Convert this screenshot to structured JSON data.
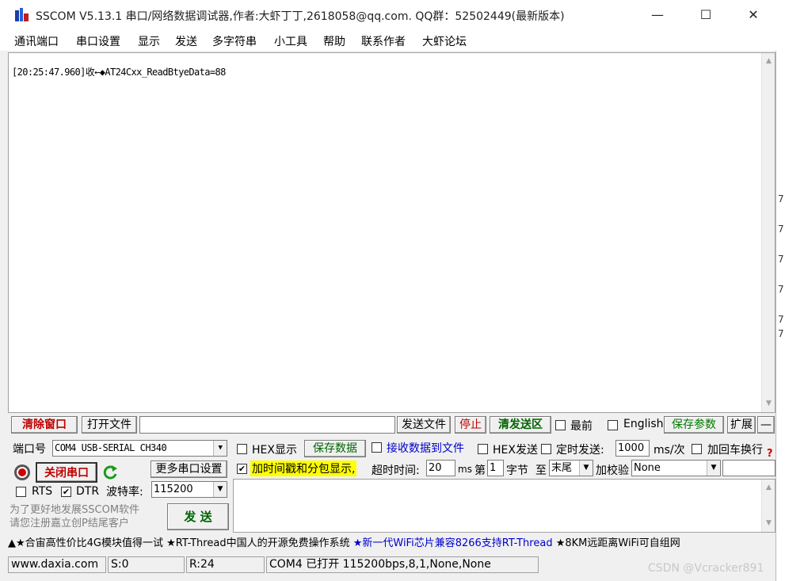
{
  "window": {
    "title": "SSCOM V5.13.1 串口/网络数据调试器,作者:大虾丁丁,2618058@qq.com. QQ群：52502449(最新版本)",
    "minimize_glyph": "—",
    "maximize_glyph": "☐",
    "close_glyph": "✕"
  },
  "menu": [
    "通讯端口",
    "串口设置",
    "显示",
    "发送",
    "多字符串",
    "小工具",
    "帮助",
    "联系作者",
    "大虾论坛"
  ],
  "receive": {
    "lines": [
      "[20:25:47.960]收←◆AT24Cxx_ReadBtyeData=88"
    ]
  },
  "toolbar": {
    "clear_window": "清除窗口",
    "open_file": "打开文件",
    "send_file": "发送文件",
    "stop": "停止",
    "clear_send": "清发送区",
    "topmost": "最前",
    "english": "English",
    "save_params": "保存参数",
    "expand": "扩展",
    "collapse": "—"
  },
  "port": {
    "port_label": "端口号",
    "port_value": "COM4 USB-SERIAL CH340",
    "close_port": "关闭串口",
    "more_settings": "更多串口设置",
    "rts": "RTS",
    "dtr": "DTR",
    "baud_label": "波特率:",
    "baud_value": "115200",
    "promo": [
      "为了更好地发展SSCOM软件",
      "请您注册嘉立创P结尾客户"
    ],
    "send_button": "发 送"
  },
  "options": {
    "hex_display": "HEX显示",
    "save_data": "保存数据",
    "recv_to_file": "接收数据到文件",
    "hex_send": "HEX发送",
    "timed_send": "定时发送:",
    "timed_value": "1000",
    "timed_unit": "ms/次",
    "add_crlf": "加回车换行",
    "timestamp": "加时间戳和分包显示,",
    "timeout_label": "超时时间:",
    "timeout_value": "20",
    "timeout_unit": "ms",
    "byte_prefix": "第",
    "byte_value": "1",
    "byte_suffix": "字节",
    "to_label": "至",
    "to_value": "末尾",
    "checksum_label": "加校验",
    "checksum_value": "None",
    "help_glyph": "?"
  },
  "ticker": {
    "segments": [
      {
        "text": "▲★合宙高性价比4G模块值得一试 ★RT-Thread中国人的开源免费操作系统 ",
        "color": "#000000"
      },
      {
        "text": "★新一代WiFi芯片兼容8266支持RT-Thread ",
        "color": "#0000cc"
      },
      {
        "text": "★8KM远距离WiFi可自组网",
        "color": "#000000"
      }
    ]
  },
  "status": {
    "website": "www.daxia.com",
    "sent": "S:0",
    "received": "R:24",
    "port_status": "COM4 已打开  115200bps,8,1,None,None"
  },
  "watermark": "CSDN @Vcracker891"
}
